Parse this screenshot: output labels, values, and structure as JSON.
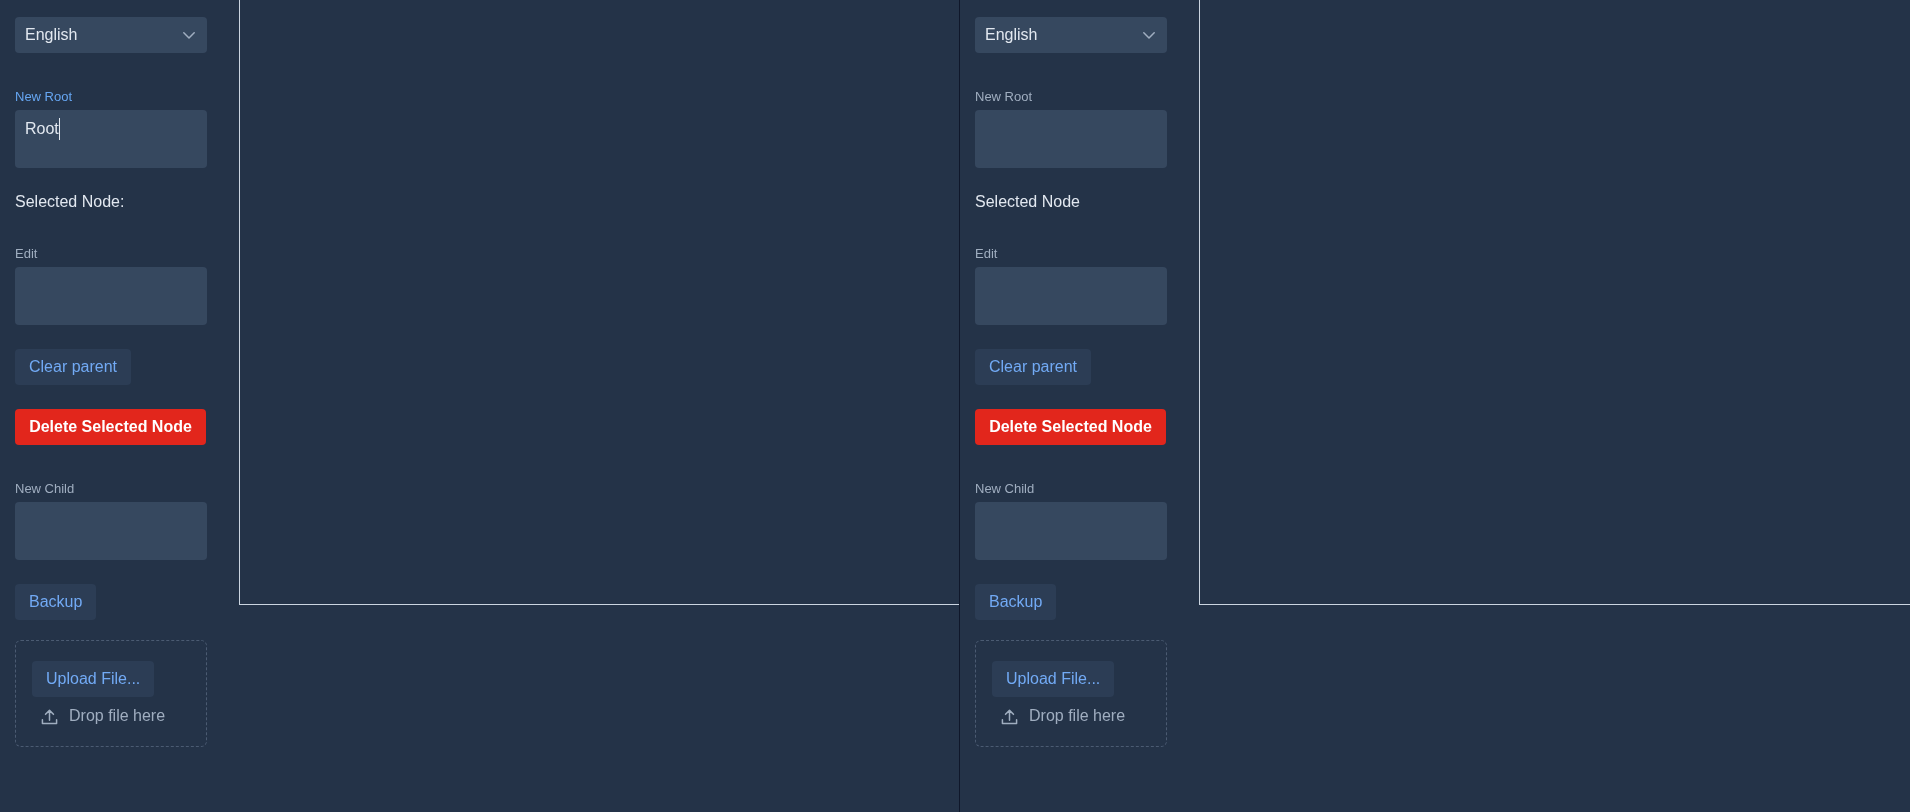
{
  "panels": [
    {
      "language": "English",
      "new_root_field": {
        "label": "New Root",
        "value": "Root",
        "focused": true
      },
      "selected_node_label": "Selected Node:",
      "edit_field": {
        "label": "Edit",
        "focused": false
      },
      "clear_parent_button": "Clear parent",
      "delete_button": "Delete Selected Node",
      "new_child_field": {
        "label": "New Child",
        "focused": false
      },
      "backup_button": "Backup",
      "upload": {
        "button": "Upload File...",
        "hint": "Drop file here"
      }
    },
    {
      "language": "English",
      "new_root_field": {
        "label": "New Root",
        "focused": false
      },
      "selected_node_label": "Selected Node",
      "edit_field": {
        "label": "Edit",
        "focused": false
      },
      "clear_parent_button": "Clear parent",
      "delete_button": "Delete Selected Node",
      "new_child_field": {
        "label": "New Child",
        "focused": false
      },
      "backup_button": "Backup",
      "upload": {
        "button": "Upload File...",
        "hint": "Drop file here"
      }
    }
  ]
}
